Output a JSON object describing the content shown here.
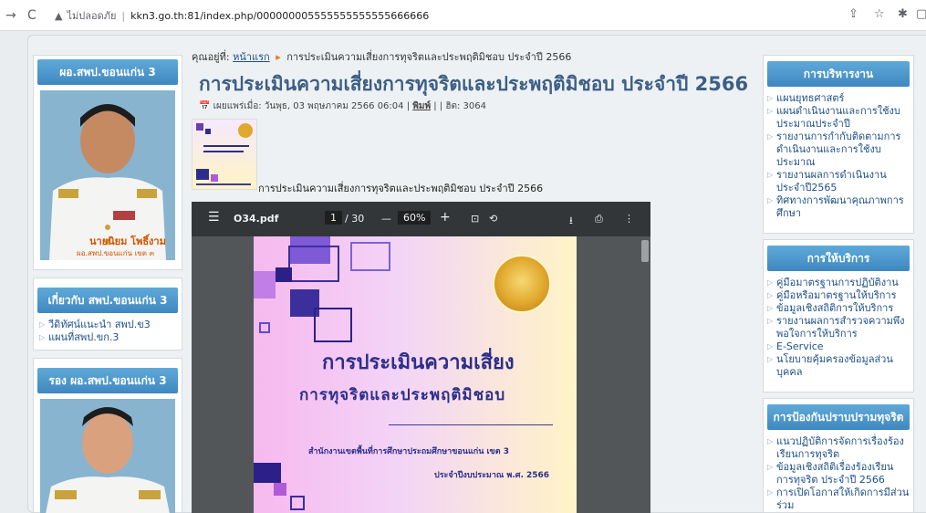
{
  "browser": {
    "insecure_label": "ไม่ปลอดภัย",
    "url": "kkn3.go.th:81/index.php/000000005555555555555666666"
  },
  "left": {
    "director_title": "ผอ.สพป.ขอนแก่น 3",
    "director_name": "นายนิยม โพธิ์งาม",
    "director_position": "ผอ.สพป.ขอนแก่น เขต ๓",
    "about_title": "เกี่ยวกับ สพป.ขอนแก่น 3",
    "about_items": [
      "วีดิทัศน์แนะนำ สพป.ข3",
      "แผนที่สพป.ขก.3"
    ],
    "deputy_title": "รอง ผอ.สพป.ขอนแก่น 3"
  },
  "center": {
    "crumb_prefix": "คุณอยู่ที่:",
    "crumb_home": "หน้าแรก",
    "crumb_current": "การประเมินความเสี่ยงการทุจริตและประพฤติมิชอบ ประจำปี 2566",
    "title": "การประเมินความเสี่ยงการทุจริตและประพฤติมิชอบ ประจำปี 2566",
    "published_label": "เผยแพร่เมื่อ: วันพุธ, 03 พฤษภาคม 2566 06:04",
    "print_label": "พิมพ์",
    "hits_label": "ฮิต: 3064",
    "caption": "การประเมินความเสี่ยงการทุจริตและประพฤติมิชอบ ประจำปี 2566"
  },
  "pdf": {
    "filename": "O34.pdf",
    "page_current": "1",
    "page_total": "/ 30",
    "zoom": "60%",
    "heading1": "การประเมินความเสี่ยง",
    "heading2": "การทุจริตและประพฤติมิชอบ",
    "office": "สำนักงานเขตพื้นที่การศึกษาประถมศึกษาขอนแก่น เขต 3",
    "budget_year": "ประจำปีงบประมาณ พ.ศ. 2566"
  },
  "right": {
    "admin_title": "การบริหารงาน",
    "admin_items": [
      "แผนยุทธศาสตร์",
      "แผนดำเนินงานและการใช้งบประมาณประจำปี",
      "รายงานการกำกับติดตามการดำเนินงานและการใช้งบประมาณ",
      "รายงานผลการดำเนินงานประจำปี2565",
      "ทิศทางการพัฒนาคุณภาพการศึกษา"
    ],
    "service_title": "การให้บริการ",
    "service_items": [
      "คู่มือมาตรฐานการปฏิบัติงาน",
      "คู่มือหรือมาตรฐานให้บริการ",
      "ข้อมูลเชิงสถิติการให้บริการ",
      "รายงานผลการสำรวจความพึงพอใจการให้บริการ",
      "E-Service",
      "นโยบายคุ้มครองข้อมูลส่วนบุคคล"
    ],
    "anti_title": "การป้องกันปราบปรามทุจริต",
    "anti_items": [
      "แนวปฏิบัติการจัดการเรื่องร้องเรียนการทุจริต",
      "ข้อมูลเชิงสถิติเรื่องร้องเรียนการทุจริต ประจำปี 2566",
      "การเปิดโอกาสให้เกิดการมีส่วนร่วม"
    ]
  }
}
